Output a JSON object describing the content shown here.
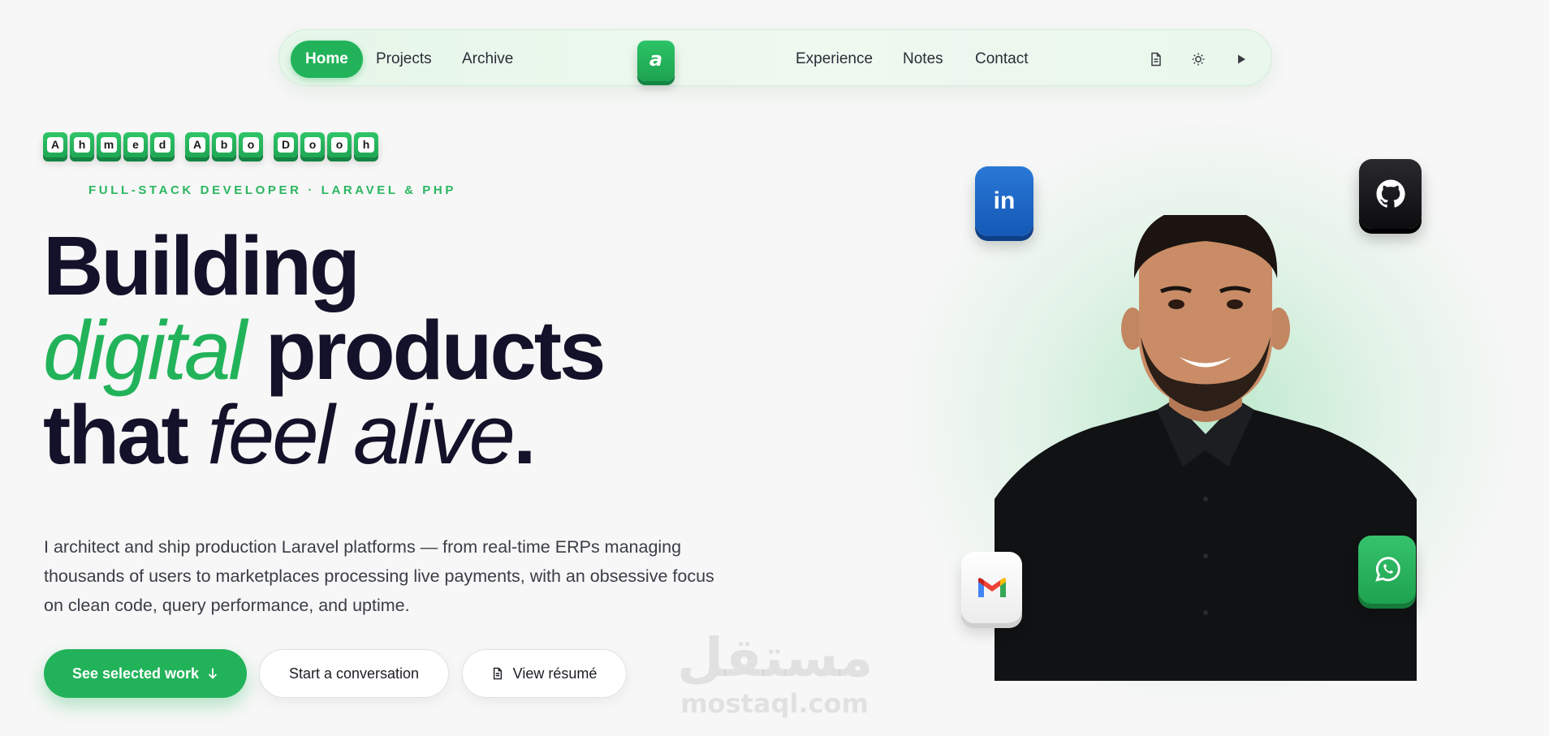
{
  "nav": {
    "items": [
      {
        "label": "Home",
        "active": true
      },
      {
        "label": "Projects"
      },
      {
        "label": "Archive"
      },
      {
        "label": "Experience"
      },
      {
        "label": "Notes"
      },
      {
        "label": "Contact"
      }
    ],
    "logo_letter": "a",
    "icons": [
      "document-icon",
      "sun-icon",
      "play-icon"
    ]
  },
  "hero": {
    "name_letters": [
      [
        "A",
        "h",
        "m",
        "e",
        "d"
      ],
      [
        "A",
        "b",
        "o"
      ],
      [
        "D",
        "o",
        "o",
        "h"
      ]
    ],
    "tagline": "FULL-STACK DEVELOPER · LARAVEL & PHP",
    "headline": {
      "line1": "Building",
      "line2_accent": "digital",
      "line2_rest": " products",
      "line3_plain": "that ",
      "line3_italic": "feel alive",
      "line3_end": "."
    },
    "description": "I architect and ship production Laravel platforms — from real-time ERPs managing thousands of users to marketplaces processing live payments, with an obsessive focus on clean code, query performance, and uptime.",
    "buttons": {
      "primary": "See selected work",
      "secondary": "Start a conversation",
      "resume": "View résumé"
    }
  },
  "social": {
    "linkedin_label": "in",
    "icons": [
      "linkedin-icon",
      "github-icon",
      "gmail-icon",
      "whatsapp-icon"
    ]
  },
  "watermark": {
    "arabic": "مستقل",
    "latin": "mostaql.com"
  },
  "colors": {
    "accent": "#22b35a",
    "ink": "#14122a",
    "background": "#f6f7f6"
  }
}
